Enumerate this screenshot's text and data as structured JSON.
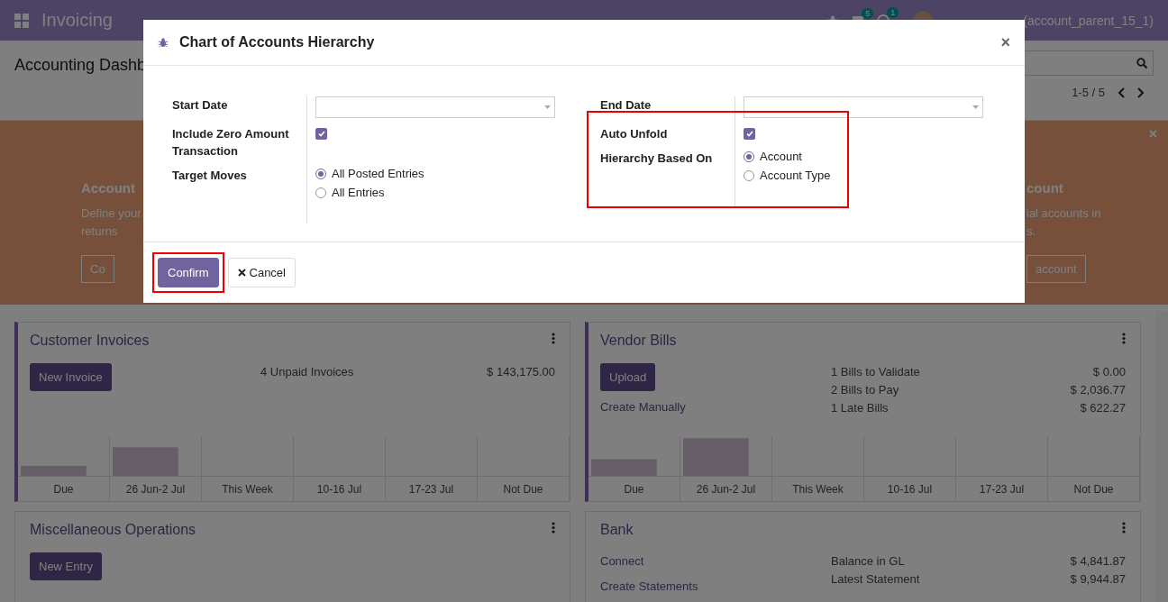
{
  "navbar": {
    "app_name": "Invoicing",
    "chat_count": "5",
    "activity_count": "1",
    "user": "(account_parent_15_1)"
  },
  "control_panel": {
    "title": "Accounting Dashb",
    "pager": "1-5 / 5"
  },
  "banner": {
    "close": "×",
    "left": {
      "title": "Account",
      "lines": [
        "Define your",
        "returns"
      ],
      "button": "Co"
    },
    "right": {
      "title": "count",
      "lines": [
        "ial accounts in",
        "s."
      ],
      "button": "account"
    }
  },
  "cards": [
    {
      "title": "Customer Invoices",
      "accent": true,
      "actions": [
        {
          "kind": "button",
          "label": "New Invoice"
        }
      ],
      "stats": [
        {
          "label": "4 Unpaid Invoices",
          "value": "$ 143,175.00"
        }
      ],
      "chart": {
        "kind": "picture",
        "categories": [
          "Due",
          "26 Jun-2 Jul",
          "This Week",
          "10-16 Jul",
          "17-23 Jul",
          "Not Due"
        ]
      }
    },
    {
      "title": "Vendor Bills",
      "accent": true,
      "actions": [
        {
          "kind": "button",
          "label": "Upload"
        },
        {
          "kind": "link",
          "label": "Create Manually"
        }
      ],
      "stats": [
        {
          "label": "1 Bills to Validate",
          "value": "$ 0.00"
        },
        {
          "label": "2 Bills to Pay",
          "value": "$ 2,036.77"
        },
        {
          "label": "1 Late Bills",
          "value": "$ 622.27"
        }
      ],
      "chart": {
        "kind": "picture",
        "categories": [
          "Due",
          "26 Jun-2 Jul",
          "This Week",
          "10-16 Jul",
          "17-23 Jul",
          "Not Due"
        ]
      }
    },
    {
      "title": "Miscellaneous Operations",
      "accent": false,
      "actions": [
        {
          "kind": "button",
          "label": "New Entry"
        }
      ]
    },
    {
      "title": "Bank",
      "accent": false,
      "actions": [
        {
          "kind": "link",
          "label": "Connect"
        },
        {
          "kind": "link",
          "label": "Create Statements"
        }
      ],
      "stats": [
        {
          "label": "Balance in GL",
          "value": "$ 4,841.87"
        },
        {
          "label": "Latest Statement",
          "value": "$ 9,944.87"
        }
      ]
    }
  ],
  "dialog": {
    "title": "Chart of Accounts Hierarchy",
    "close": "×",
    "left_fields": [
      {
        "kind": "date",
        "label": "Start Date",
        "highlighted": false
      },
      {
        "kind": "checkbox",
        "label": "Include Zero Amount Transaction",
        "checked": true,
        "highlighted": false
      },
      {
        "kind": "radio",
        "label": "Target Moves",
        "highlighted": false,
        "options": [
          {
            "label": "All Posted Entries",
            "selected": true
          },
          {
            "label": "All Entries",
            "selected": false
          }
        ]
      }
    ],
    "right_fields": [
      {
        "kind": "date",
        "label": "End Date",
        "highlighted": false
      },
      {
        "kind": "checkbox",
        "label": "Auto Unfold",
        "checked": true,
        "highlighted": true
      },
      {
        "kind": "radio",
        "label": "Hierarchy Based On",
        "highlighted": true,
        "options": [
          {
            "label": "Account",
            "selected": true
          },
          {
            "label": "Account Type",
            "selected": false
          }
        ]
      }
    ],
    "buttons": [
      {
        "kind": "primary",
        "label": "Confirm",
        "highlighted": true
      },
      {
        "kind": "secondary",
        "label": "Cancel",
        "highlighted": false
      }
    ]
  }
}
